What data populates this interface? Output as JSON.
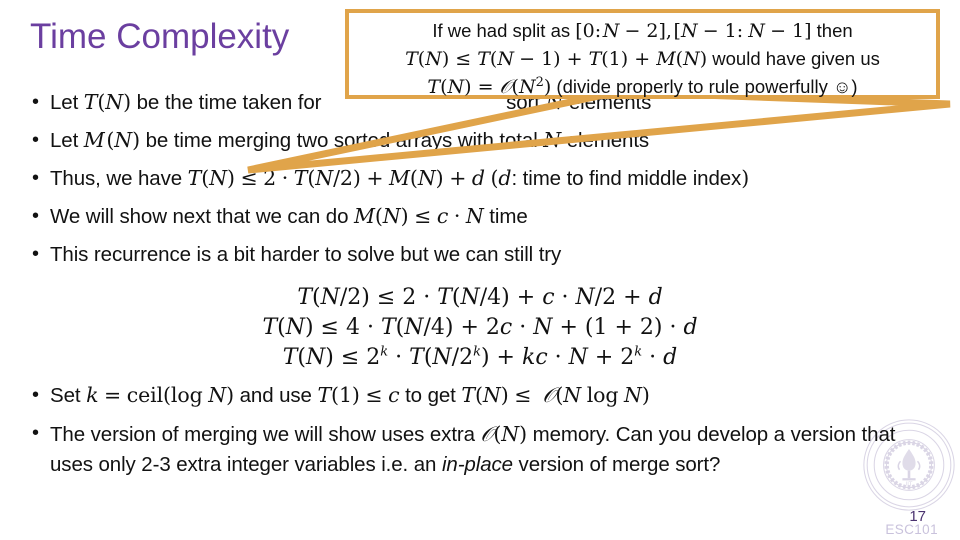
{
  "slide": {
    "title": "Time Complexity",
    "page_number": "17",
    "course_footer": "ESC101",
    "title_color": "#6B3FA0",
    "callout_border_color": "#E0A44A",
    "background_color": "#FFFFFF"
  },
  "bullets": [
    {
      "id": "bullet-1",
      "marker": "•",
      "text": "Let T(N) be the time taken for [merge] sort N elements",
      "parts_before_math": "Let ",
      "occluded": true
    },
    {
      "id": "bullet-2",
      "marker": "•",
      "text": "Let M(N) be time merging two sorted arrays with total N elements"
    },
    {
      "id": "bullet-3",
      "marker": "•",
      "text": "Thus, we have T(N) ≤ 2 · T(N/2) + M(N) + d (d: time to find middle index)"
    },
    {
      "id": "bullet-4",
      "marker": "•",
      "text": "We will show next that we can do M(N) ≤ c · N time"
    },
    {
      "id": "bullet-5",
      "marker": "•",
      "text": "This recurrence is a bit harder to solve but we can still try"
    },
    {
      "id": "bullet-6",
      "marker": "•",
      "text": "Set k = ceil(log N) and use T(1) ≤ c to get T(N) ≤ 𝒪(N log N)"
    },
    {
      "id": "bullet-7",
      "marker": "•",
      "text": "The version of merging we will show uses extra 𝒪(N) memory. Can you develop a version that uses only 2-3 extra integer variables i.e. an in-place version of merge sort?"
    }
  ],
  "equations": [
    {
      "id": "equation-1",
      "text": "T(N/2) ≤ 2 · T(N/4) + c · N/2 + d"
    },
    {
      "id": "equation-2",
      "text": "T(N) ≤ 4 · T(N/4) + 2c · N + (1 + 2) · d"
    },
    {
      "id": "equation-3",
      "text": "T(N) ≤ 2^k · T(N/2^k) + kc · N + 2^k · d"
    }
  ],
  "callout": {
    "line1": "If we had split as [0: N − 2], [N − 1: N − 1] then",
    "line2": "T(N) ≤ T(N − 1) + T(1) + M(N) would have given us",
    "line3": "T(N) = 𝒪(N²) (divide properly to rule powerfully ☺)"
  },
  "watermark": {
    "name": "iit-kanpur-seal",
    "inner_text": "IIT"
  }
}
